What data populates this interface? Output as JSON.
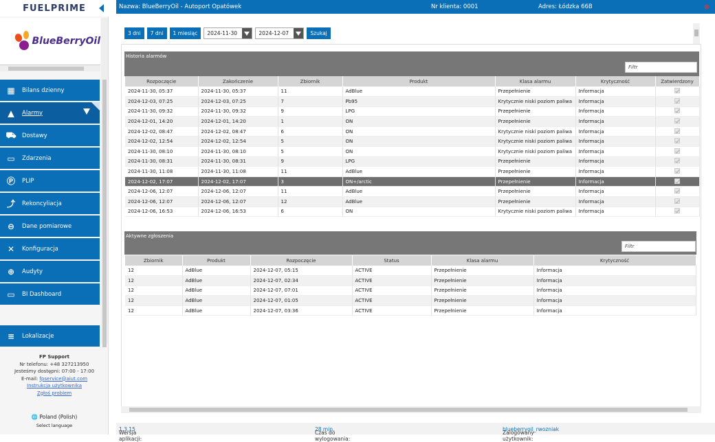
{
  "brand": "FUELPRIME",
  "company_logo": "BlueBerryOil",
  "nav": [
    {
      "label": "Bilans dzienny",
      "icon": "table-icon"
    },
    {
      "label": "Alarmy",
      "icon": "warning-icon"
    },
    {
      "label": "Dostawy",
      "icon": "truck-icon"
    },
    {
      "label": "Zdarzenia",
      "icon": "chat-icon"
    },
    {
      "label": "PLIP",
      "icon": "parking-icon"
    },
    {
      "label": "Rekoncyliacja",
      "icon": "trend-icon"
    },
    {
      "label": "Dane pomiarowe",
      "icon": "gauge-icon"
    },
    {
      "label": "Konfiguracja",
      "icon": "tools-icon"
    },
    {
      "label": "Audyty",
      "icon": "search-icon"
    },
    {
      "label": "BI Dashboard",
      "icon": "dashboard-icon"
    },
    {
      "label": "Lokalizacje",
      "icon": "list-icon"
    }
  ],
  "support": {
    "title": "FP Support",
    "phone": "Nr telefonu: +48 327213950",
    "hours": "Jesteśmy dostępni: 07:00 - 17:00",
    "email_label": "E-mail: ",
    "email": "fpservice@aiut.com",
    "manual": "Instrukcja użytkownika",
    "report": "Zgłoś problem"
  },
  "language": {
    "current": "Poland (Polish)",
    "select": "Select language"
  },
  "topbar": {
    "name": "Nazwa: BlueBerryOil - Autoport Opatówek",
    "client": "Nr klienta: 0001",
    "address": "Adres: Łódzka 66B",
    "close": "⊗"
  },
  "toolbar": {
    "b3": "3 dni",
    "b7": "7 dni",
    "b1m": "1 miesiąc",
    "date_from": "2024-11-30",
    "date_to": "2024-12-07",
    "search": "Szukaj"
  },
  "alarm_history": {
    "title": "Historia alarmów",
    "filter_placeholder": "Filtr",
    "columns": [
      "Rozpoczęcie",
      "Zakończenie",
      "Zbiornik",
      "Produkt",
      "Klasa alarmu",
      "Krytyczność",
      "Zatwierdzony"
    ],
    "rows": [
      [
        "2024-11-30, 05:37",
        "2024-11-30, 05:37",
        "11",
        "AdBlue",
        "Przepełnienie",
        "Informacja"
      ],
      [
        "2024-12-03, 07:25",
        "2024-12-03, 07:25",
        "7",
        "Pb95",
        "Krytycznie niski poziom paliwa",
        "Informacja"
      ],
      [
        "2024-11-30, 09:32",
        "2024-11-30, 09:32",
        "9",
        "LPG",
        "Przepełnienie",
        "Informacja"
      ],
      [
        "2024-12-01, 14:20",
        "2024-12-01, 14:20",
        "1",
        "ON",
        "Przepełnienie",
        "Informacja"
      ],
      [
        "2024-12-02, 08:47",
        "2024-12-02, 08:47",
        "6",
        "ON",
        "Krytycznie niski poziom paliwa",
        "Informacja"
      ],
      [
        "2024-12-02, 12:54",
        "2024-12-02, 12:54",
        "5",
        "ON",
        "Krytycznie niski poziom paliwa",
        "Informacja"
      ],
      [
        "2024-11-30, 08:10",
        "2024-11-30, 08:10",
        "5",
        "ON",
        "Krytycznie niski poziom paliwa",
        "Informacja"
      ],
      [
        "2024-11-30, 08:31",
        "2024-11-30, 08:31",
        "9",
        "LPG",
        "Przepełnienie",
        "Informacja"
      ],
      [
        "2024-11-30, 11:08",
        "2024-11-30, 11:08",
        "11",
        "AdBlue",
        "Przepełnienie",
        "Informacja"
      ],
      [
        "2024-12-02, 17:07",
        "2024-12-02, 17:07",
        "3",
        "ON+/arctic",
        "Przepełnienie",
        "Informacja"
      ],
      [
        "2024-12-06, 12:07",
        "2024-12-06, 12:07",
        "11",
        "AdBlue",
        "Przepełnienie",
        "Informacja"
      ],
      [
        "2024-12-06, 12:07",
        "2024-12-06, 12:07",
        "12",
        "AdBlue",
        "Przepełnienie",
        "Informacja"
      ],
      [
        "2024-12-06, 16:53",
        "2024-12-06, 16:53",
        "6",
        "ON",
        "Krytycznie niski poziom paliwa",
        "Informacja"
      ]
    ]
  },
  "active_reports": {
    "title": "Aktywne zgłoszenia",
    "filter_placeholder": "Filtr",
    "columns": [
      "Zbiornik",
      "Produkt",
      "Rozpoczęcie",
      "Status",
      "Klasa alarmu",
      "Krytyczność"
    ],
    "rows": [
      [
        "12",
        "AdBlue",
        "2024-12-07, 05:15",
        "ACTIVE",
        "Przepełnienie",
        "Informacja"
      ],
      [
        "12",
        "AdBlue",
        "2024-12-07, 02:34",
        "ACTIVE",
        "Przepełnienie",
        "Informacja"
      ],
      [
        "12",
        "AdBlue",
        "2024-12-07, 07:01",
        "ACTIVE",
        "Przepełnienie",
        "Informacja"
      ],
      [
        "12",
        "AdBlue",
        "2024-12-07, 01:05",
        "ACTIVE",
        "Przepełnienie",
        "Informacja"
      ],
      [
        "12",
        "AdBlue",
        "2024-12-07, 03:36",
        "ACTIVE",
        "Przepełnienie",
        "Informacja"
      ]
    ]
  },
  "footer": {
    "version_label": "Wersja aplikacji: ",
    "version": "1.3.15",
    "logout_label": "Czas do wylogowania: ",
    "logout": "28 min.",
    "user_label": "Zalogowany użytkownik: ",
    "user": "blueberryoil_rwozniak"
  }
}
